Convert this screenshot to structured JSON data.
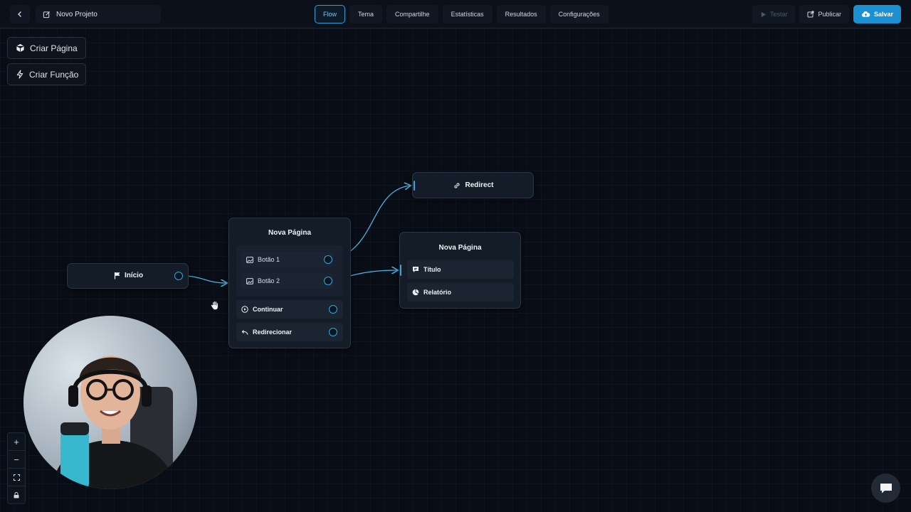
{
  "topbar": {
    "back_icon": "chevron-left-icon",
    "project_icon": "edit-icon",
    "project_name": "Novo Projeto",
    "tabs": [
      {
        "label": "Flow",
        "active": true
      },
      {
        "label": "Tema"
      },
      {
        "label": "Compartilhe"
      },
      {
        "label": "Estatísticas"
      },
      {
        "label": "Resultados"
      },
      {
        "label": "Configurações"
      }
    ],
    "actions": {
      "testar": "Testar",
      "publicar": "Publicar",
      "salvar": "Salvar"
    }
  },
  "sidebar": {
    "criar_pagina": "Criar Página",
    "criar_funcao": "Criar Função"
  },
  "nodes": {
    "inicio": {
      "label": "Início",
      "icon": "flag-icon"
    },
    "nova_pagina_1": {
      "title": "Nova Página",
      "rows": [
        "Botão 1",
        "Botão 2"
      ],
      "continuar": "Continuar",
      "redirecionar": "Redirecionar"
    },
    "redirect": {
      "label": "Redirect",
      "icon": "link-icon"
    },
    "nova_pagina_2": {
      "title": "Nova Página",
      "titulo": "Título",
      "relatorio": "Relatório"
    }
  },
  "zoom": {
    "plus": "+",
    "minus": "−"
  },
  "colors": {
    "accent": "#35a5dd",
    "primary_button": "#1a8fd1",
    "background": "#090d15"
  }
}
